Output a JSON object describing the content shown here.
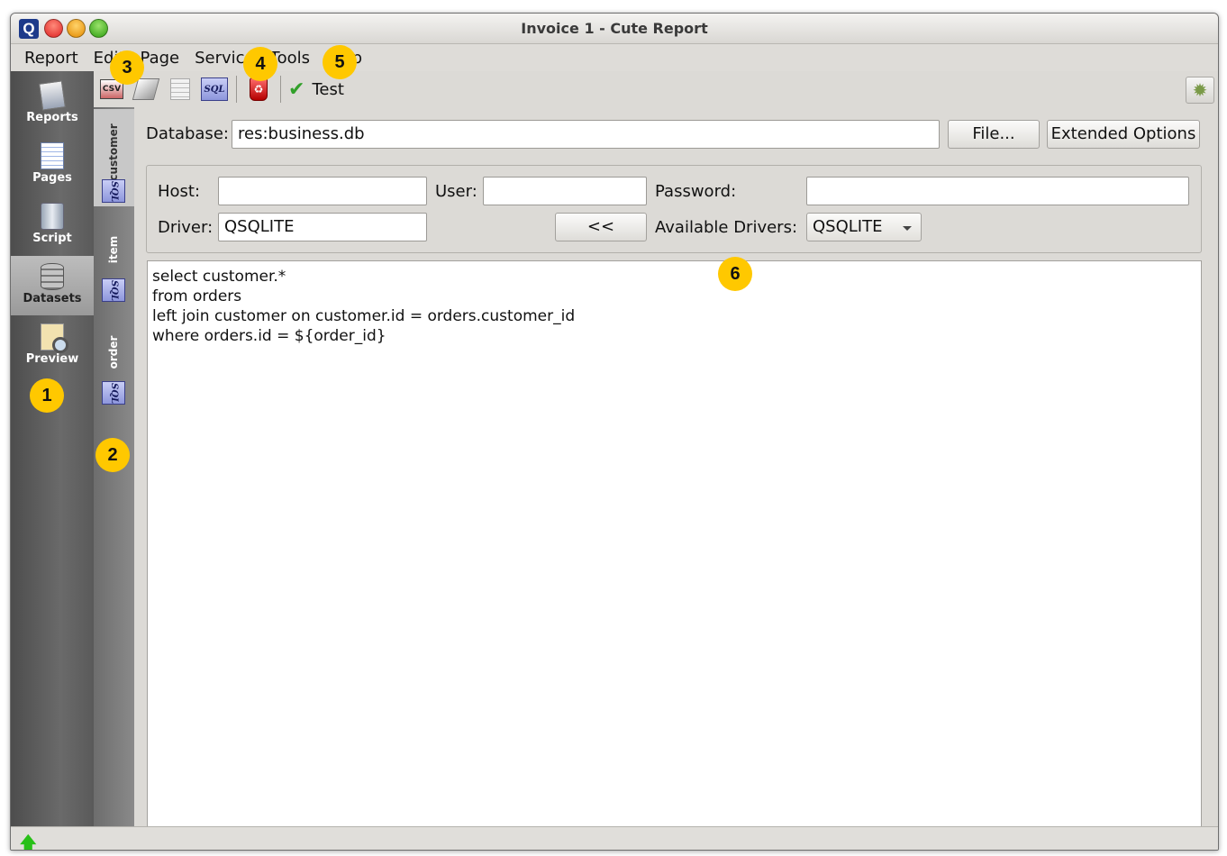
{
  "window": {
    "title": "Invoice 1 - Cute Report",
    "logo": "Q"
  },
  "menubar": {
    "items": [
      "Report",
      "Edit",
      "Page",
      "Service",
      "Tools",
      "Help"
    ]
  },
  "left_panel": {
    "items": [
      {
        "label": "Reports",
        "icon": "reports-icon"
      },
      {
        "label": "Pages",
        "icon": "pages-icon"
      },
      {
        "label": "Script",
        "icon": "script-icon"
      },
      {
        "label": "Datasets",
        "icon": "datasets-icon",
        "active": true
      },
      {
        "label": "Preview",
        "icon": "preview-icon"
      }
    ]
  },
  "dataset_tabs": [
    {
      "label": "customer",
      "badge": "SQL",
      "active": true
    },
    {
      "label": "item",
      "badge": "SQL"
    },
    {
      "label": "order",
      "badge": "SQL"
    }
  ],
  "toolbar": {
    "csv_label": "CSV",
    "sql_label": "SQL",
    "test_label": "Test"
  },
  "form": {
    "database_label": "Database:",
    "database_value": "res:business.db",
    "file_button": "File...",
    "extended_button": "Extended Options",
    "host_label": "Host:",
    "host_value": "",
    "user_label": "User:",
    "user_value": "",
    "password_label": "Password:",
    "password_value": "",
    "driver_label": "Driver:",
    "driver_value": "QSQLITE",
    "copy_button": "<<",
    "available_drivers_label": "Available Drivers:",
    "available_drivers_value": "QSQLITE"
  },
  "editor": {
    "lines": [
      "select customer.*",
      "from orders",
      "left join customer on customer.id = orders.customer_id",
      "where orders.id = ${order_id}"
    ]
  },
  "callouts": [
    "1",
    "2",
    "3",
    "4",
    "5",
    "6"
  ],
  "colors": {
    "callout": "#ffc800",
    "sidebar": "#5a5a5a",
    "check": "#32a02a"
  }
}
